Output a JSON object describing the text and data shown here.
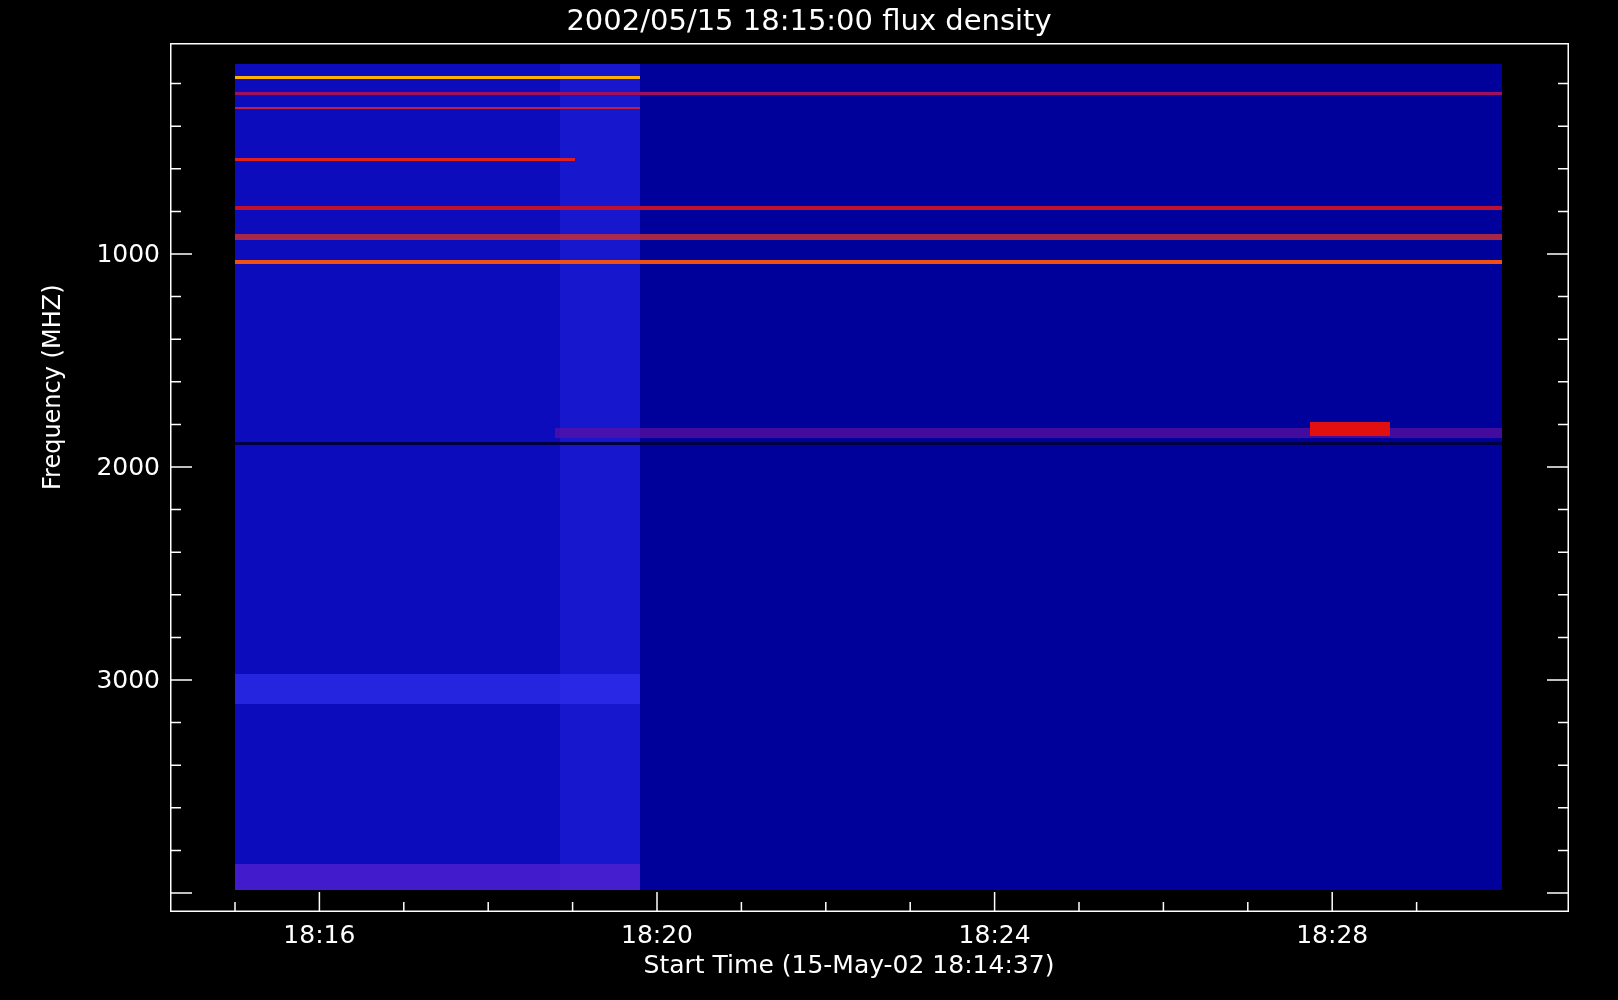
{
  "title": "2002/05/15 18:15:00 flux density",
  "chart": {
    "ylabel": "Frequency (MHZ)",
    "xlabel": "Start Time (15-May-02 18:14:37)",
    "yticks": [
      "1000",
      "2000",
      "3000"
    ],
    "xticks": [
      "18:16",
      "18:20",
      "18:24",
      "18:28"
    ]
  }
}
